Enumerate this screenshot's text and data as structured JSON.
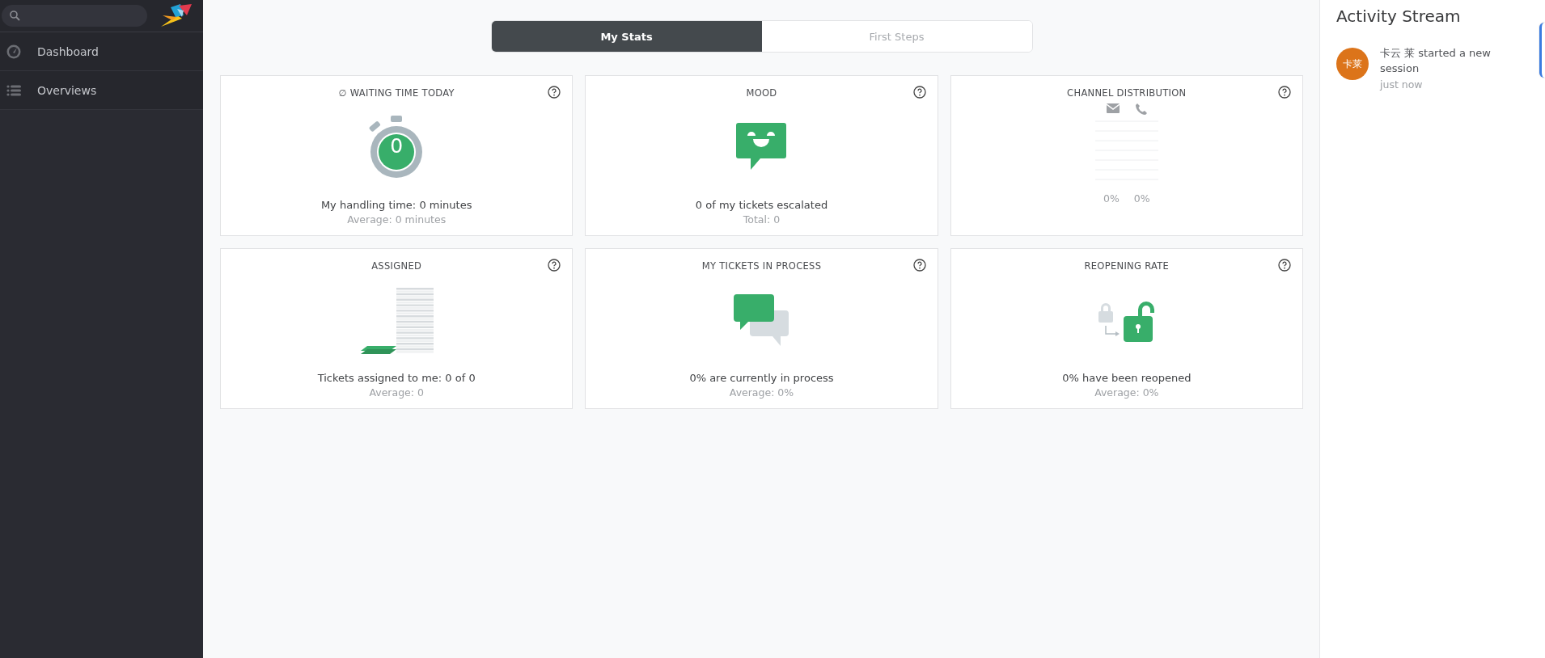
{
  "sidebar": {
    "items": [
      {
        "label": "Dashboard",
        "kind": "dashboard"
      },
      {
        "label": "Overviews",
        "kind": "list"
      }
    ]
  },
  "tabs": [
    {
      "label": "My Stats",
      "selected": true
    },
    {
      "label": "First Steps",
      "selected": false
    }
  ],
  "widgets": [
    {
      "kind": "waiting",
      "title": "∅ WAITING TIME TODAY",
      "value": "0",
      "main": "My handling time: 0 minutes",
      "sub": "Average: 0 minutes"
    },
    {
      "kind": "mood",
      "title": "MOOD",
      "main": "0 of my tickets escalated",
      "sub": "Total: 0"
    },
    {
      "kind": "channel",
      "title": "CHANNEL DISTRIBUTION",
      "percentages": [
        "0%",
        "0%"
      ]
    },
    {
      "kind": "assigned",
      "title": "ASSIGNED",
      "main": "Tickets assigned to me: 0 of 0",
      "sub": "Average: 0"
    },
    {
      "kind": "process",
      "title": "MY TICKETS IN PROCESS",
      "main": "0% are currently in process",
      "sub": "Average: 0%"
    },
    {
      "kind": "reopen",
      "title": "REOPENING RATE",
      "main": "0% have been reopened",
      "sub": "Average: 0%"
    }
  ],
  "activity": {
    "title": "Activity Stream",
    "entries": [
      {
        "avatar": "卡莱",
        "text": "卡云 莱 started a new session",
        "time": "just now"
      }
    ]
  }
}
